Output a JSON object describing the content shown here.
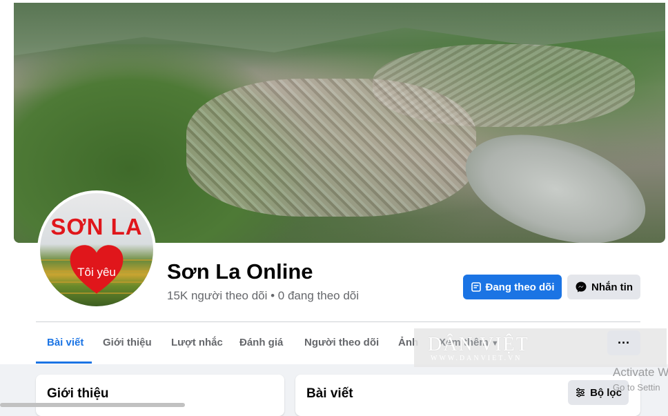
{
  "page": {
    "name": "Sơn La Online",
    "followers": "15K người theo dõi • 0 đang theo dõi"
  },
  "avatar": {
    "title": "SƠN LA",
    "heart_text": "Tôi yêu"
  },
  "actions": {
    "follow_label": "Đang theo dõi",
    "message_label": "Nhắn tin",
    "more_label": "···"
  },
  "tabs": [
    {
      "label": "Bài viết",
      "active": true
    },
    {
      "label": "Giới thiệu"
    },
    {
      "label": "Lượt nhắc"
    },
    {
      "label": "Đánh giá"
    },
    {
      "label": "Người theo dõi"
    },
    {
      "label": "Ảnh"
    },
    {
      "label": "Xem thêm"
    }
  ],
  "watermark": {
    "main": "DÂN VIỆT",
    "sub": "WWW.DANVIET.VN"
  },
  "windows_notice": {
    "line1": "Activate W",
    "line2": "Go to Settin"
  },
  "cards": {
    "intro_title": "Giới thiệu",
    "posts_title": "Bài viết",
    "filter_label": "Bộ lọc"
  },
  "colors": {
    "accent": "#1b74e4",
    "secondary_button": "#e4e6eb",
    "background": "#f0f2f5"
  }
}
